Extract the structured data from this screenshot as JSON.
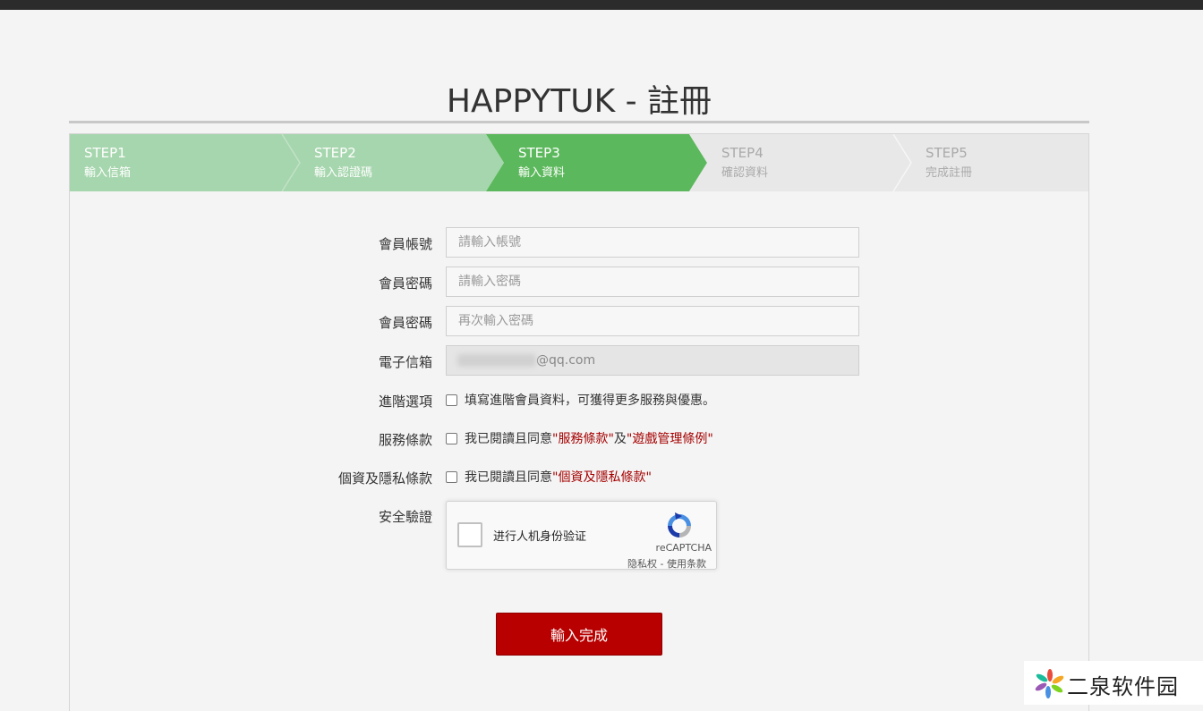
{
  "page": {
    "title": "HAPPYTUK - 註冊"
  },
  "steps": [
    {
      "num": "STEP1",
      "label": "輸入信箱",
      "state": "done"
    },
    {
      "num": "STEP2",
      "label": "輸入認證碼",
      "state": "done"
    },
    {
      "num": "STEP3",
      "label": "輸入資料",
      "state": "current"
    },
    {
      "num": "STEP4",
      "label": "確認資料",
      "state": "pending"
    },
    {
      "num": "STEP5",
      "label": "完成註冊",
      "state": "pending"
    }
  ],
  "form": {
    "account": {
      "label": "會員帳號",
      "placeholder": "請輸入帳號",
      "value": ""
    },
    "password": {
      "label": "會員密碼",
      "placeholder": "請輸入密碼",
      "value": ""
    },
    "password_confirm": {
      "label": "會員密碼",
      "placeholder": "再次輸入密碼",
      "value": ""
    },
    "email": {
      "label": "電子信箱",
      "value_suffix": "@qq.com"
    },
    "advanced": {
      "label": "進階選項",
      "text": "填寫進階會員資料，可獲得更多服務與優惠。"
    },
    "terms": {
      "label": "服務條款",
      "prefix": "我已閱讀且同意",
      "link1": "\"服務條款\"",
      "join": "及",
      "link2": "\"遊戲管理條例\""
    },
    "privacy": {
      "label": "個資及隱私條款",
      "prefix": "我已閱讀且同意",
      "link": "\"個資及隱私條款\""
    },
    "security": {
      "label": "安全驗證"
    },
    "submit_label": "輸入完成"
  },
  "recaptcha": {
    "checkbox_label": "进行人机身份验证",
    "brand": "reCAPTCHA",
    "links": "隐私权 - 使用条款"
  },
  "watermark": {
    "text": "二泉软件园"
  },
  "colors": {
    "step_done": "#a6d6ad",
    "step_current": "#5cb85c",
    "step_pending": "#e8e8e8",
    "submit": "#b80000",
    "link": "#a50000"
  }
}
